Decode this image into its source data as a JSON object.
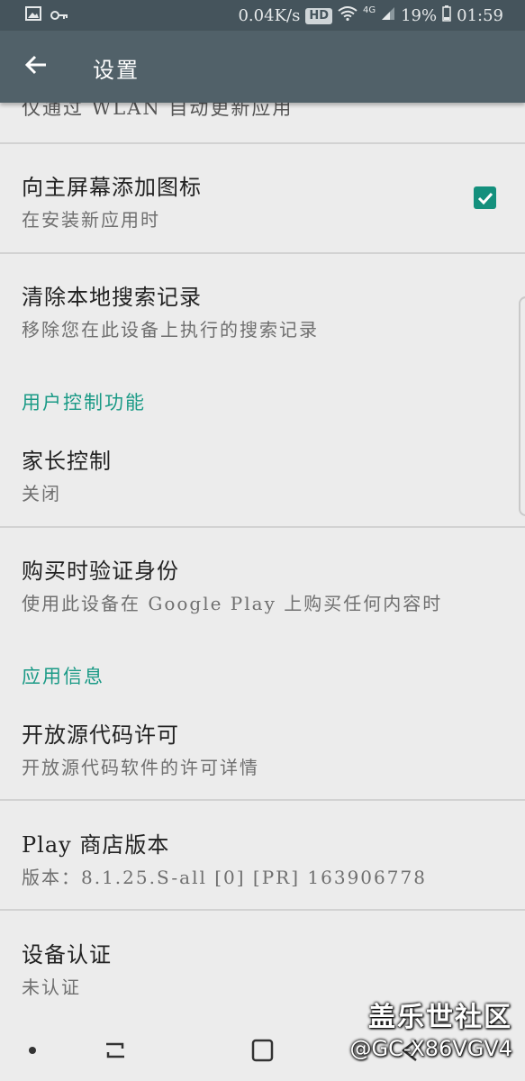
{
  "status_bar": {
    "net_speed": "0.04K/s",
    "hd": "HD",
    "network": "4G",
    "battery": "19%",
    "time": "01:59",
    "icons": [
      "image-icon",
      "key-icon",
      "wifi-icon",
      "signal-icon",
      "battery-icon"
    ]
  },
  "app_bar": {
    "title": "设置",
    "back_icon": "arrow-left-icon"
  },
  "settings": {
    "cut_row_sub": "仅通过 WLAN 自动更新应用",
    "add_icon": {
      "title": "向主屏幕添加图标",
      "sub": "在安装新应用时",
      "checked": true
    },
    "clear_search": {
      "title": "清除本地搜索记录",
      "sub": "移除您在此设备上执行的搜索记录"
    },
    "user_controls_header": "用户控制功能",
    "parental": {
      "title": "家长控制",
      "sub": "关闭"
    },
    "purchase_auth": {
      "title": "购买时验证身份",
      "sub": "使用此设备在 Google Play 上购买任何内容时"
    },
    "app_info_header": "应用信息",
    "open_source": {
      "title": "开放源代码许可",
      "sub": "开放源代码软件的许可详情"
    },
    "version": {
      "title": "Play 商店版本",
      "sub": "版本：8.1.25.S-all [0] [PR] 163906778"
    },
    "certification": {
      "title": "设备认证",
      "sub": "未认证"
    }
  },
  "watermark": {
    "title": "盖乐世社区",
    "user": "@GC-X86VGV4"
  },
  "colors": {
    "accent": "#1a9a86",
    "app_bar": "#516169",
    "status_bar": "#45545c",
    "background": "#ececec"
  }
}
